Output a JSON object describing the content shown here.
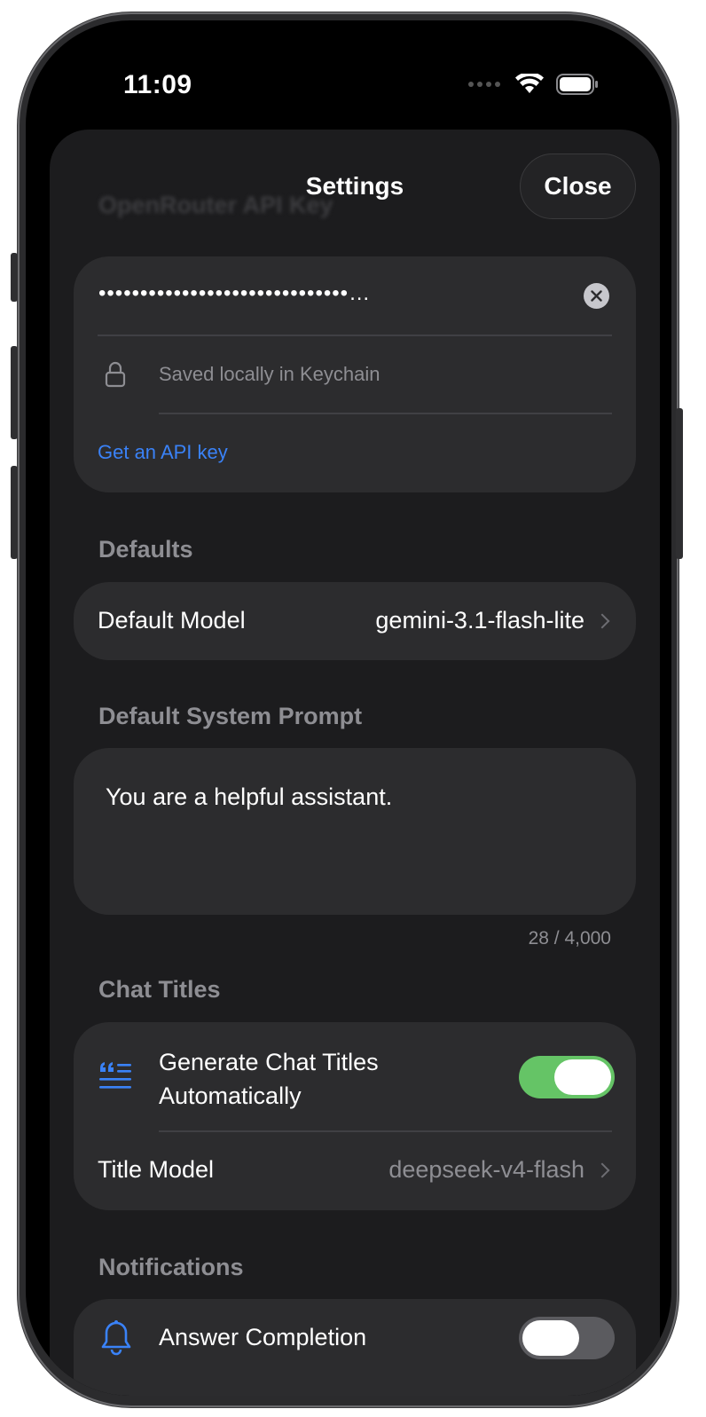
{
  "status_bar": {
    "time": "11:09"
  },
  "nav": {
    "title": "Settings",
    "close_label": "Close"
  },
  "api_key": {
    "header": "OpenRouter API Key",
    "masked_value": "••••••••••••••••••••••••••••••…",
    "keychain_note": "Saved locally in Keychain",
    "link_label": "Get an API key"
  },
  "defaults": {
    "header": "Defaults",
    "model_label": "Default Model",
    "model_value": "gemini-3.1-flash-lite"
  },
  "system_prompt": {
    "header": "Default System Prompt",
    "text": "You are a helpful assistant.",
    "char_count": "28 / 4,000"
  },
  "chat_titles": {
    "header": "Chat Titles",
    "generate_label_line1": "Generate Chat Titles",
    "generate_label_line2": "Automatically",
    "generate_enabled": true,
    "title_model_label": "Title Model",
    "title_model_value": "deepseek-v4-flash"
  },
  "notifications": {
    "header": "Notifications",
    "answer_label": "Answer Completion",
    "answer_enabled": false
  },
  "colors": {
    "accent": "#3a82f7",
    "toggle_on": "#65c466",
    "toggle_off": "#5b5b5f",
    "card_bg": "#2c2c2e",
    "sheet_bg": "#1c1c1e"
  }
}
